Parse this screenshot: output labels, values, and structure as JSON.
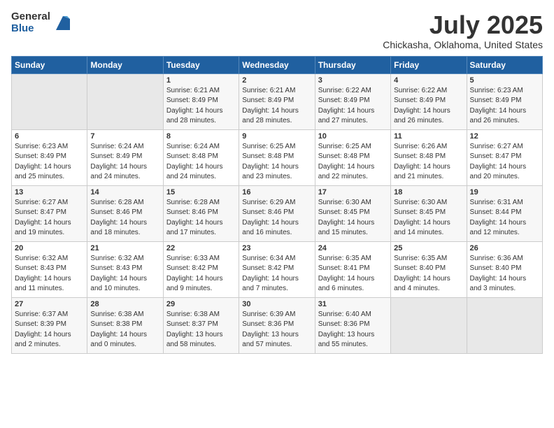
{
  "logo": {
    "general": "General",
    "blue": "Blue"
  },
  "header": {
    "month": "July 2025",
    "location": "Chickasha, Oklahoma, United States"
  },
  "weekdays": [
    "Sunday",
    "Monday",
    "Tuesday",
    "Wednesday",
    "Thursday",
    "Friday",
    "Saturday"
  ],
  "weeks": [
    [
      {
        "day": "",
        "info": ""
      },
      {
        "day": "",
        "info": ""
      },
      {
        "day": "1",
        "info": "Sunrise: 6:21 AM\nSunset: 8:49 PM\nDaylight: 14 hours\nand 28 minutes."
      },
      {
        "day": "2",
        "info": "Sunrise: 6:21 AM\nSunset: 8:49 PM\nDaylight: 14 hours\nand 28 minutes."
      },
      {
        "day": "3",
        "info": "Sunrise: 6:22 AM\nSunset: 8:49 PM\nDaylight: 14 hours\nand 27 minutes."
      },
      {
        "day": "4",
        "info": "Sunrise: 6:22 AM\nSunset: 8:49 PM\nDaylight: 14 hours\nand 26 minutes."
      },
      {
        "day": "5",
        "info": "Sunrise: 6:23 AM\nSunset: 8:49 PM\nDaylight: 14 hours\nand 26 minutes."
      }
    ],
    [
      {
        "day": "6",
        "info": "Sunrise: 6:23 AM\nSunset: 8:49 PM\nDaylight: 14 hours\nand 25 minutes."
      },
      {
        "day": "7",
        "info": "Sunrise: 6:24 AM\nSunset: 8:49 PM\nDaylight: 14 hours\nand 24 minutes."
      },
      {
        "day": "8",
        "info": "Sunrise: 6:24 AM\nSunset: 8:48 PM\nDaylight: 14 hours\nand 24 minutes."
      },
      {
        "day": "9",
        "info": "Sunrise: 6:25 AM\nSunset: 8:48 PM\nDaylight: 14 hours\nand 23 minutes."
      },
      {
        "day": "10",
        "info": "Sunrise: 6:25 AM\nSunset: 8:48 PM\nDaylight: 14 hours\nand 22 minutes."
      },
      {
        "day": "11",
        "info": "Sunrise: 6:26 AM\nSunset: 8:48 PM\nDaylight: 14 hours\nand 21 minutes."
      },
      {
        "day": "12",
        "info": "Sunrise: 6:27 AM\nSunset: 8:47 PM\nDaylight: 14 hours\nand 20 minutes."
      }
    ],
    [
      {
        "day": "13",
        "info": "Sunrise: 6:27 AM\nSunset: 8:47 PM\nDaylight: 14 hours\nand 19 minutes."
      },
      {
        "day": "14",
        "info": "Sunrise: 6:28 AM\nSunset: 8:46 PM\nDaylight: 14 hours\nand 18 minutes."
      },
      {
        "day": "15",
        "info": "Sunrise: 6:28 AM\nSunset: 8:46 PM\nDaylight: 14 hours\nand 17 minutes."
      },
      {
        "day": "16",
        "info": "Sunrise: 6:29 AM\nSunset: 8:46 PM\nDaylight: 14 hours\nand 16 minutes."
      },
      {
        "day": "17",
        "info": "Sunrise: 6:30 AM\nSunset: 8:45 PM\nDaylight: 14 hours\nand 15 minutes."
      },
      {
        "day": "18",
        "info": "Sunrise: 6:30 AM\nSunset: 8:45 PM\nDaylight: 14 hours\nand 14 minutes."
      },
      {
        "day": "19",
        "info": "Sunrise: 6:31 AM\nSunset: 8:44 PM\nDaylight: 14 hours\nand 12 minutes."
      }
    ],
    [
      {
        "day": "20",
        "info": "Sunrise: 6:32 AM\nSunset: 8:43 PM\nDaylight: 14 hours\nand 11 minutes."
      },
      {
        "day": "21",
        "info": "Sunrise: 6:32 AM\nSunset: 8:43 PM\nDaylight: 14 hours\nand 10 minutes."
      },
      {
        "day": "22",
        "info": "Sunrise: 6:33 AM\nSunset: 8:42 PM\nDaylight: 14 hours\nand 9 minutes."
      },
      {
        "day": "23",
        "info": "Sunrise: 6:34 AM\nSunset: 8:42 PM\nDaylight: 14 hours\nand 7 minutes."
      },
      {
        "day": "24",
        "info": "Sunrise: 6:35 AM\nSunset: 8:41 PM\nDaylight: 14 hours\nand 6 minutes."
      },
      {
        "day": "25",
        "info": "Sunrise: 6:35 AM\nSunset: 8:40 PM\nDaylight: 14 hours\nand 4 minutes."
      },
      {
        "day": "26",
        "info": "Sunrise: 6:36 AM\nSunset: 8:40 PM\nDaylight: 14 hours\nand 3 minutes."
      }
    ],
    [
      {
        "day": "27",
        "info": "Sunrise: 6:37 AM\nSunset: 8:39 PM\nDaylight: 14 hours\nand 2 minutes."
      },
      {
        "day": "28",
        "info": "Sunrise: 6:38 AM\nSunset: 8:38 PM\nDaylight: 14 hours\nand 0 minutes."
      },
      {
        "day": "29",
        "info": "Sunrise: 6:38 AM\nSunset: 8:37 PM\nDaylight: 13 hours\nand 58 minutes."
      },
      {
        "day": "30",
        "info": "Sunrise: 6:39 AM\nSunset: 8:36 PM\nDaylight: 13 hours\nand 57 minutes."
      },
      {
        "day": "31",
        "info": "Sunrise: 6:40 AM\nSunset: 8:36 PM\nDaylight: 13 hours\nand 55 minutes."
      },
      {
        "day": "",
        "info": ""
      },
      {
        "day": "",
        "info": ""
      }
    ]
  ]
}
